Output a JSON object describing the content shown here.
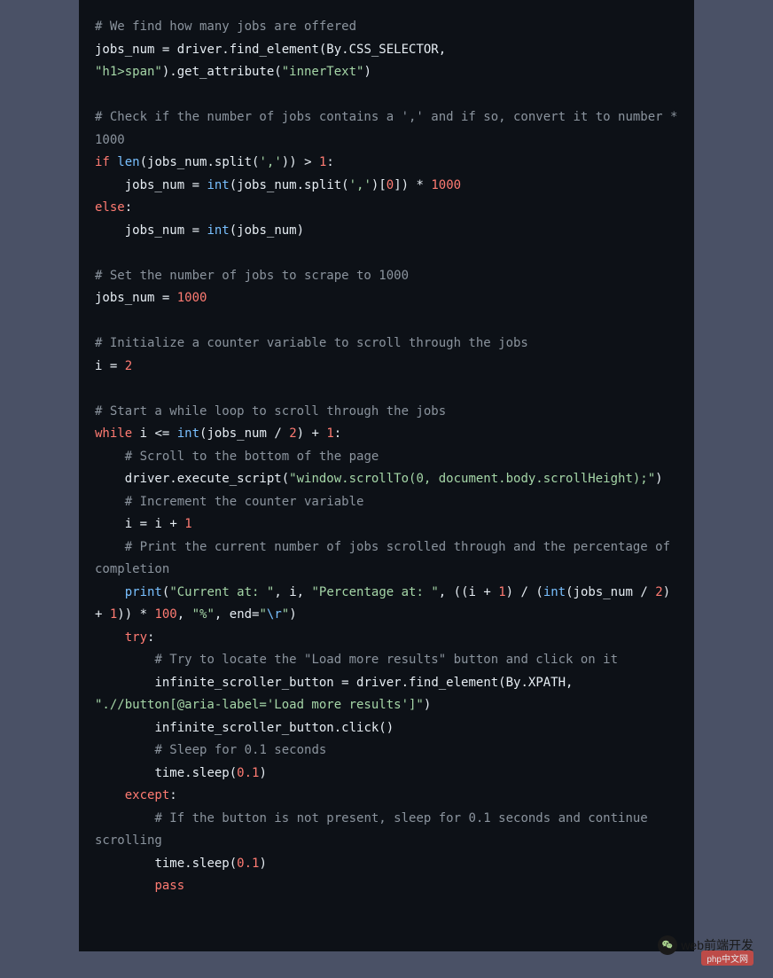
{
  "code": {
    "c1": "# We find how many jobs are offered",
    "l1_jobs_num": "jobs_num",
    "l1_eq": " = ",
    "l1_driver": "driver.find_element(By.CSS_SELECTOR, ",
    "l1_sel": "\"h1>span\"",
    "l1_get": ").get_attribute(",
    "l1_inner": "\"innerText\"",
    "l1_close": ")",
    "c2": "# Check if the number of jobs contains a ',' and if so, convert it to number * 1000",
    "kw_if": "if",
    "fn_len": "len",
    "paren_open": "(",
    "var_jobs_num": "jobs_num",
    "dot_split": ".split(",
    "str_comma": "','",
    "close_paren_paren": "))",
    "gt": " > ",
    "num_1": "1",
    "colon": ":",
    "indent1": "    ",
    "l3_jobs_num": "jobs_num",
    "l3_eq": " = ",
    "fn_int": "int",
    "l3_jobs_split": "(jobs_num.split(",
    "l3_brkt": ")[",
    "num_0": "0",
    "l3_brkt_close": "])",
    "mul": " * ",
    "num_1000": "1000",
    "kw_else": "else",
    "l4_jobs": "jobs_num",
    "l4_eq": " = ",
    "l4_int_open": "(jobs_num)",
    "c3": "# Set the number of jobs to scrape to 1000",
    "l5_jobs": "jobs_num",
    "l5_eq": " = ",
    "c4": "# Initialize a counter variable to scroll through the jobs",
    "l6_i": "i",
    "l6_eq": " = ",
    "num_2": "2",
    "c5": "# Start a while loop to scroll through the jobs",
    "kw_while": "while",
    "l7_cond1": " i <= ",
    "l7_int_open": "(jobs_num / ",
    "l7_plus": ") + ",
    "c6": "# Scroll to the bottom of the page",
    "l8_driver": "driver.execute_script(",
    "l8_str": "\"window.scrollTo(0, document.body.scrollHeight);\"",
    "l8_close": ")",
    "c7": "# Increment the counter variable",
    "l9_i": "i",
    "l9_eq": " = ",
    "l9_i2": "i",
    "l9_plus": " + ",
    "c8": "# Print the current number of jobs scrolled through and the percentage of completion",
    "fn_print": "print",
    "l10_open": "(",
    "str_current": "\"Current at: \"",
    "comma_sp": ", ",
    "l10_i": "i",
    "str_perc": "\"Percentage at: \"",
    "l10_expr1": "((i + ",
    "l10_expr2": ") / (",
    "l10_expr3": "(jobs_num / ",
    "l10_expr4": ") + ",
    "l10_expr5": ")) * ",
    "num_100": "100",
    "str_pct": "\"%\"",
    "l10_end": "end=",
    "str_cr_q1": "\"",
    "str_cr_esc": "\\r",
    "str_cr_q2": "\"",
    "kw_try": "try",
    "c9": "# Try to locate the \"Load more results\" button and click on it",
    "l11_var": "infinite_scroller_button",
    "l11_eq": " = ",
    "l11_driver": "driver.find_element(By.XPATH, ",
    "str_xpath": "\".//button[@aria-label='Load more results']\"",
    "l11_close": ")",
    "l12_click": "infinite_scroller_button.click()",
    "c10": "# Sleep for 0.1 seconds",
    "l13_sleep": "time.sleep(",
    "num_01": "0.1",
    "l13_close": ")",
    "kw_except": "except",
    "c11": "# If the button is not present, sleep for 0.1 seconds and continue scrolling",
    "kw_pass": "pass"
  },
  "author": {
    "name": "web前端开发"
  },
  "watermark": {
    "text": "php中文网"
  }
}
